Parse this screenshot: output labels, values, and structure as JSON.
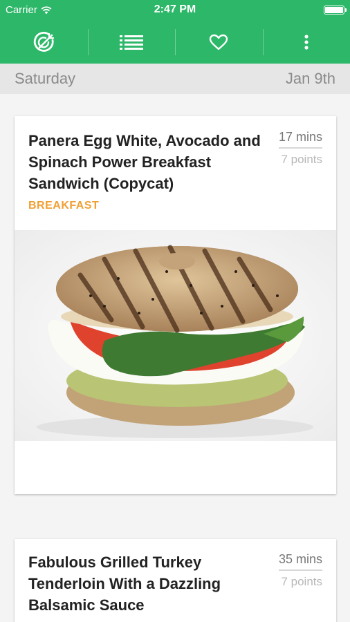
{
  "status_bar": {
    "carrier": "Carrier",
    "time": "2:47 PM",
    "battery_level": 1.0
  },
  "toolbar": {
    "items": [
      {
        "icon": "meal-planner-icon"
      },
      {
        "icon": "list-icon"
      },
      {
        "icon": "heart-icon"
      },
      {
        "icon": "more-vertical-icon"
      }
    ]
  },
  "date_bar": {
    "day": "Saturday",
    "date": "Jan 9th"
  },
  "recipes": [
    {
      "title": "Panera Egg White, Avocado and Spinach Power Breakfast Sandwich (Copycat)",
      "time": "17 mins",
      "points": "7 points",
      "category": "BREAKFAST"
    },
    {
      "title": "Fabulous Grilled Turkey Tenderloin With a Dazzling Balsamic Sauce",
      "time": "35 mins",
      "points": "7 points"
    }
  ],
  "colors": {
    "brand_green": "#2db768",
    "category_orange": "#f0a033"
  }
}
